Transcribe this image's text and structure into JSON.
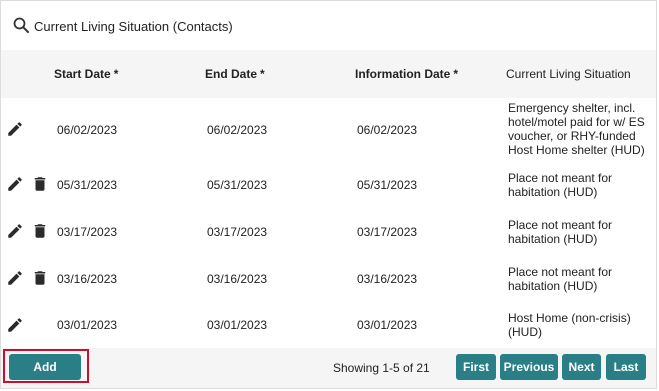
{
  "search": {
    "title": "Current Living Situation (Contacts)"
  },
  "table": {
    "headers": {
      "start_date": "Start Date",
      "end_date": "End Date",
      "information_date": "Information Date",
      "required_marker": "*",
      "current_living_situation": "Current Living Situation"
    },
    "rows": [
      {
        "start_date": "06/02/2023",
        "end_date": "06/02/2023",
        "information_date": "06/02/2023",
        "situation": "Emergency shelter, incl. hotel/motel paid for w/ ES voucher, or RHY-funded Host Home shelter (HUD)",
        "actions": [
          "edit-icon"
        ]
      },
      {
        "start_date": "05/31/2023",
        "end_date": "05/31/2023",
        "information_date": "05/31/2023",
        "situation": "Place not meant for habitation (HUD)",
        "actions": [
          "edit-icon",
          "trash-icon"
        ]
      },
      {
        "start_date": "03/17/2023",
        "end_date": "03/17/2023",
        "information_date": "03/17/2023",
        "situation": "Place not meant for habitation (HUD)",
        "actions": [
          "edit-icon",
          "trash-icon"
        ]
      },
      {
        "start_date": "03/16/2023",
        "end_date": "03/16/2023",
        "information_date": "03/16/2023",
        "situation": "Place not meant for habitation (HUD)",
        "actions": [
          "edit-icon",
          "trash-icon"
        ]
      },
      {
        "start_date": "03/01/2023",
        "end_date": "03/01/2023",
        "information_date": "03/01/2023",
        "situation": "Host Home (non-crisis) (HUD)",
        "actions": [
          "edit-icon"
        ]
      }
    ]
  },
  "footer": {
    "add_label": "Add",
    "showing_text": "Showing 1-5 of 21",
    "pagination": {
      "first": "First",
      "previous": "Previous",
      "next": "Next",
      "last": "Last"
    }
  },
  "colors": {
    "button_teal": "#2a7f86",
    "highlight_red": "#c8102e",
    "icon_dark": "#2b2b2b"
  }
}
